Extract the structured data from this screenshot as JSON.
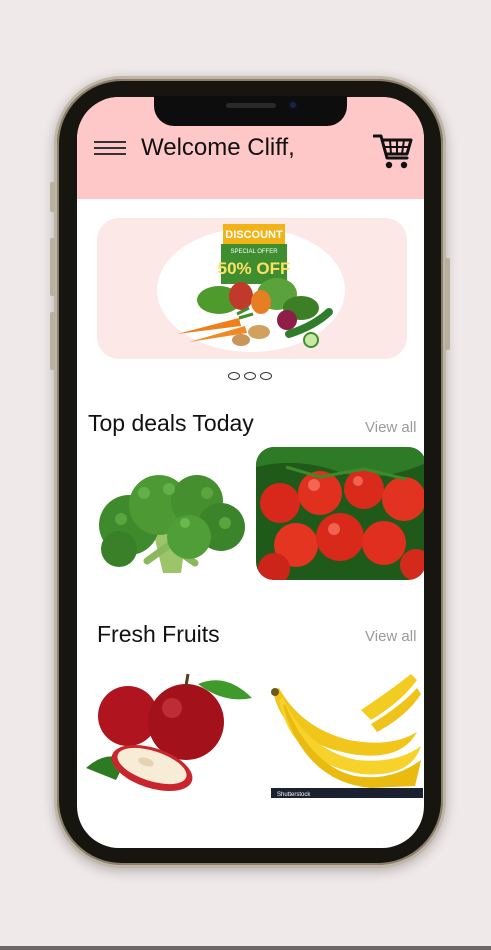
{
  "header": {
    "welcome_text": "Welcome Cliff,",
    "menu_icon": "hamburger-menu-icon",
    "cart_icon": "shopping-cart-icon",
    "background_color": "#ffc8c8"
  },
  "banner": {
    "badge_text": "DISCOUNT",
    "special_offer_text": "SPECIAL OFFER",
    "offer_text": "50% OFF",
    "carousel_dots": 3
  },
  "sections": [
    {
      "title": "Top deals Today",
      "view_all_label": "View all",
      "items": [
        {
          "name": "broccoli"
        },
        {
          "name": "tomatoes"
        }
      ]
    },
    {
      "title": "Fresh Fruits",
      "view_all_label": "View all",
      "items": [
        {
          "name": "apples"
        },
        {
          "name": "bananas",
          "watermark": "Shutterstock"
        }
      ]
    }
  ]
}
